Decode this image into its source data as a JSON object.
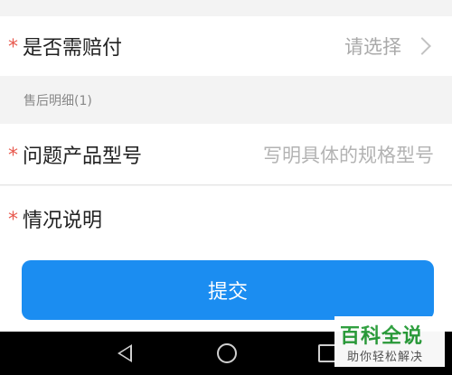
{
  "form": {
    "compensation": {
      "required_mark": "*",
      "label": "是否需赔付",
      "value": "请选择"
    },
    "section_title": "售后明细(1)",
    "model": {
      "required_mark": "*",
      "label": "问题产品型号",
      "placeholder": "写明具体的规格型号"
    },
    "description": {
      "required_mark": "*",
      "label": "情况说明"
    },
    "submit_label": "提交"
  },
  "watermark": {
    "main": "百科全说",
    "sub": "助你轻松解决"
  },
  "navbar": {
    "icons": [
      "back-icon",
      "home-icon",
      "recent-apps-icon"
    ]
  },
  "colors": {
    "accent": "#1b8df1",
    "required": "#e85a4f",
    "watermark": "#2a9d3a"
  }
}
